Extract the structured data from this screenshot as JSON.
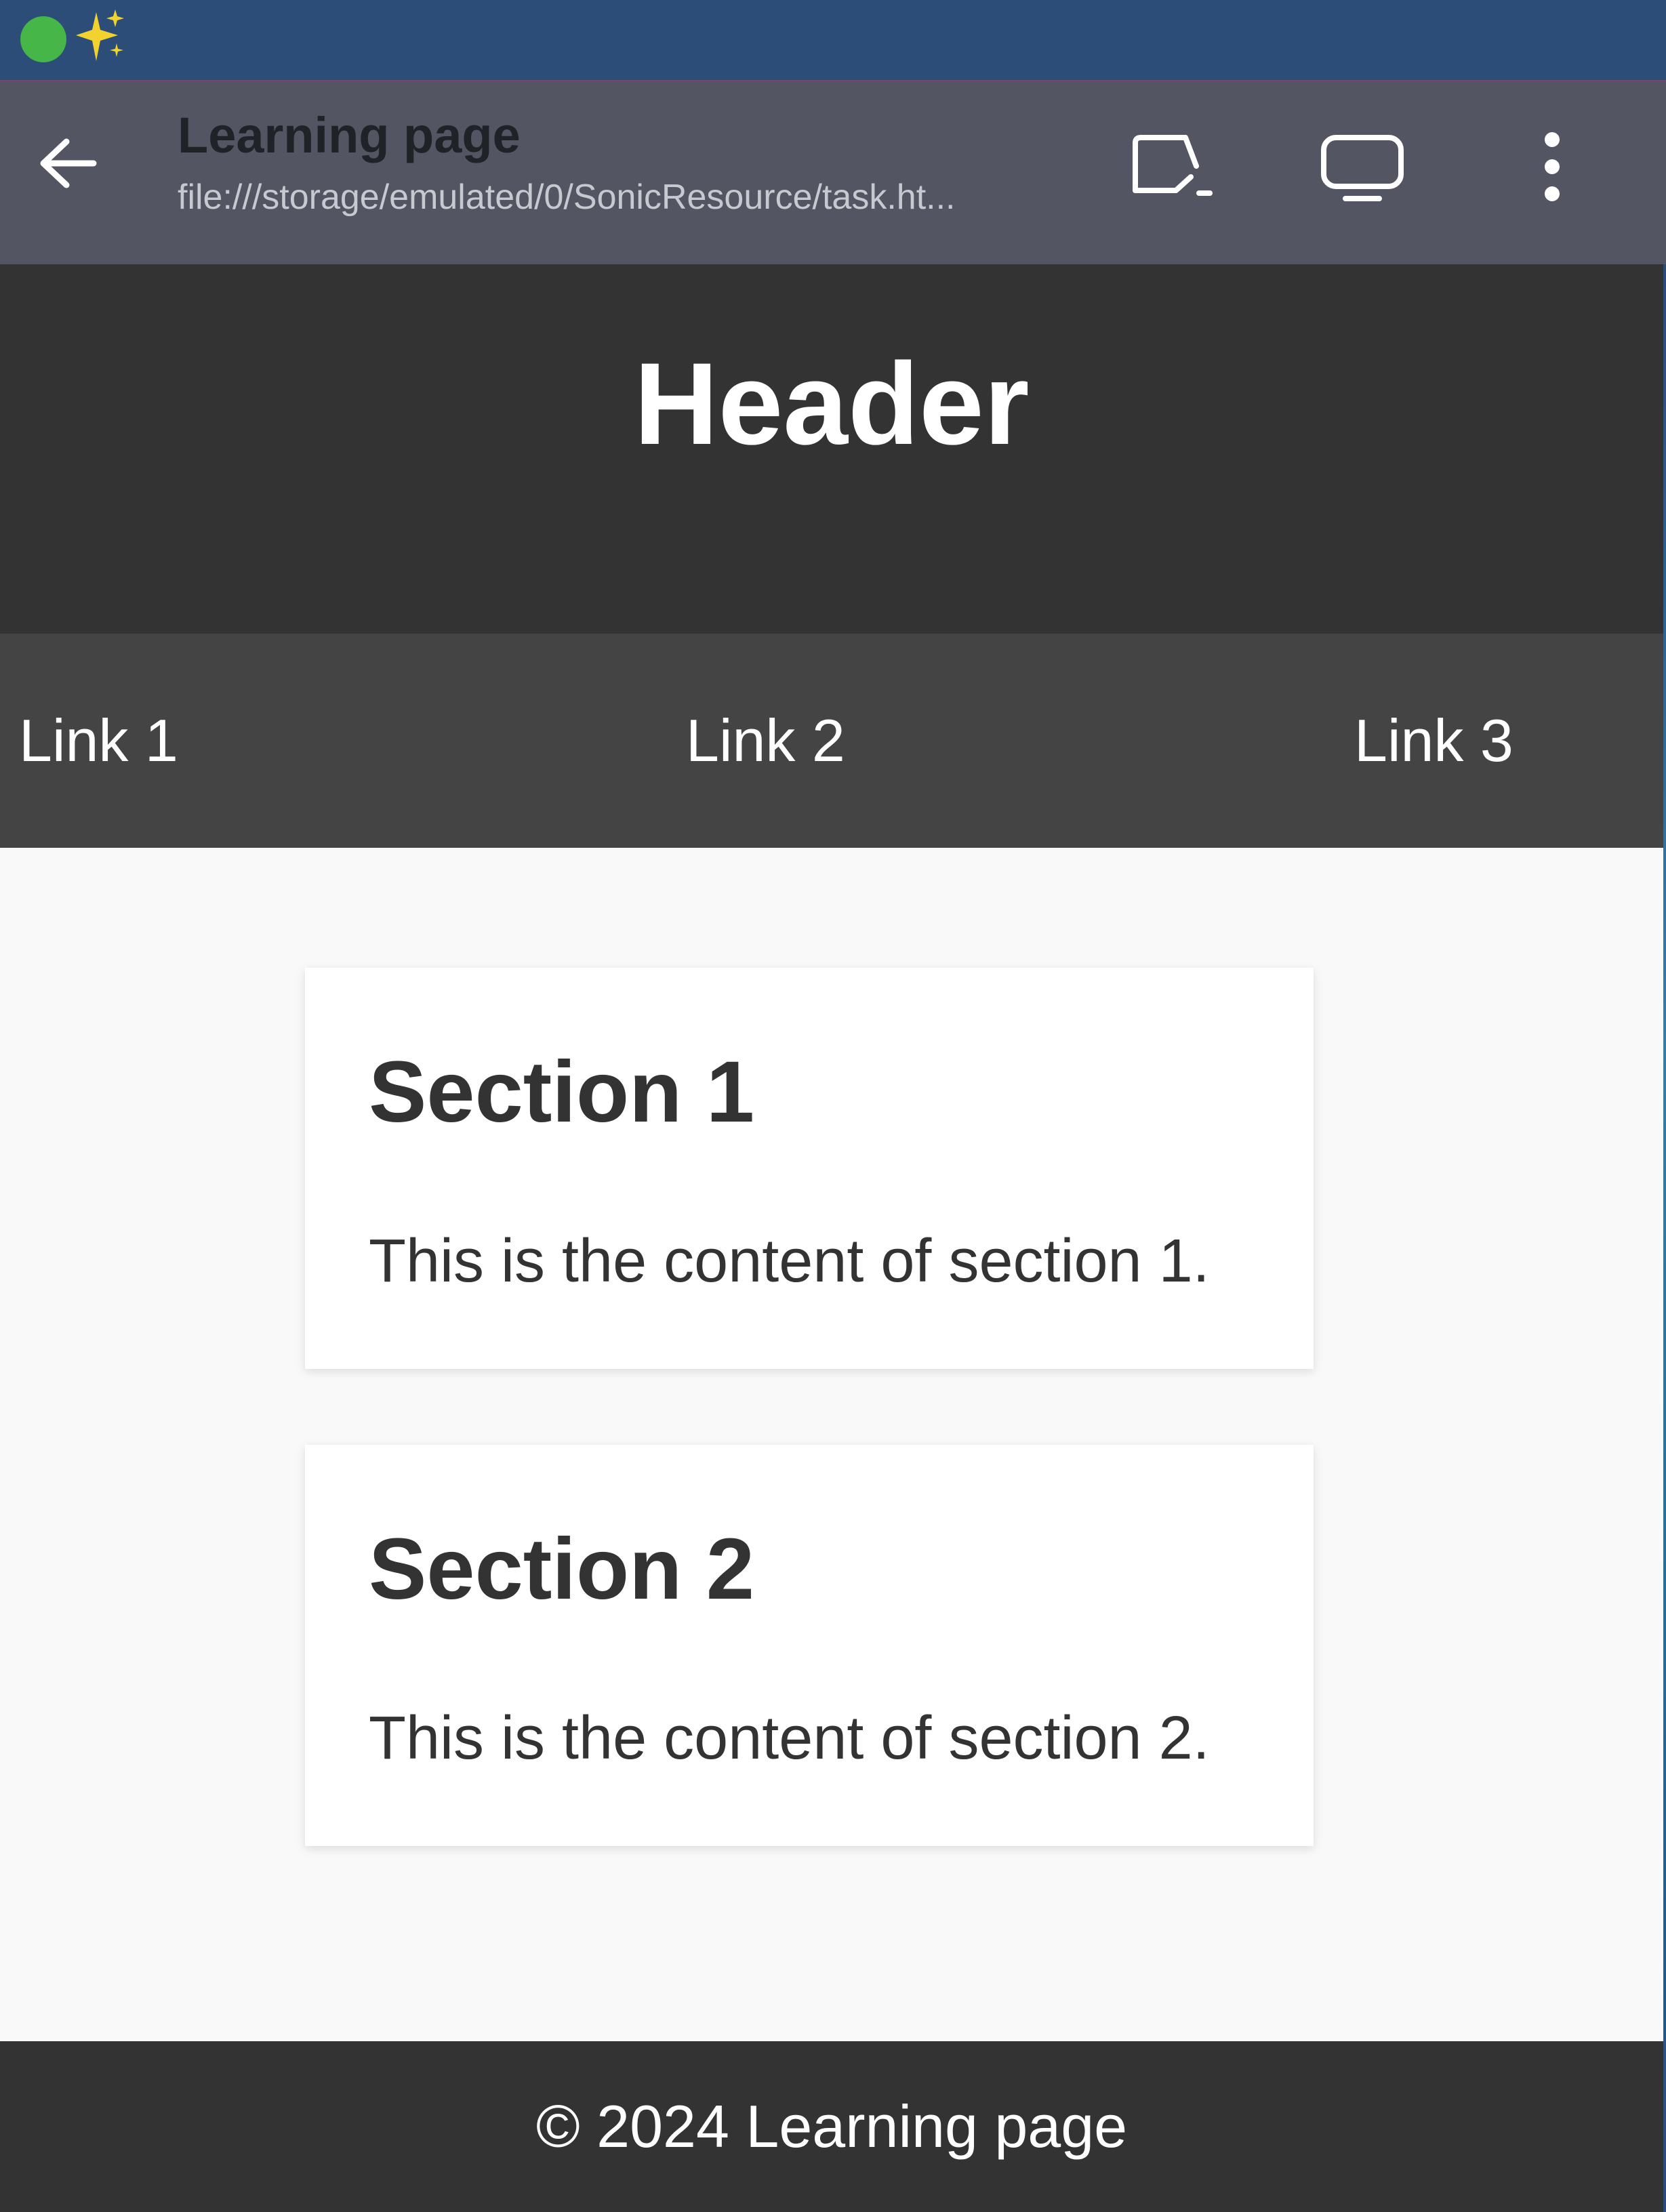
{
  "status_bar": {
    "icons": [
      "status-dot",
      "sparkle-icon"
    ],
    "colors": {
      "background": "#2b4d78",
      "dot": "#46b649",
      "sparkle": "#f2d22e"
    }
  },
  "app_bar": {
    "title": "Learning page",
    "url": "file:///storage/emulated/0/SonicResource/task.ht...",
    "icons": [
      "back-arrow-icon",
      "cast-icon",
      "desktop-icon",
      "more-vertical-icon"
    ],
    "colors": {
      "background": "#535662"
    }
  },
  "page": {
    "header": {
      "title": "Header"
    },
    "nav": {
      "links": [
        {
          "label": "Link 1"
        },
        {
          "label": "Link 2"
        },
        {
          "label": "Link 3"
        }
      ]
    },
    "sections": [
      {
        "title": "Section 1",
        "content": "This is the content of section 1."
      },
      {
        "title": "Section 2",
        "content": "This is the content of section 2."
      }
    ],
    "footer": {
      "text": "© 2024 Learning page"
    },
    "colors": {
      "header_bg": "#333333",
      "nav_bg": "#444444",
      "body_bg": "#f9f9f9",
      "card_bg": "#ffffff",
      "text": "#333333"
    }
  }
}
